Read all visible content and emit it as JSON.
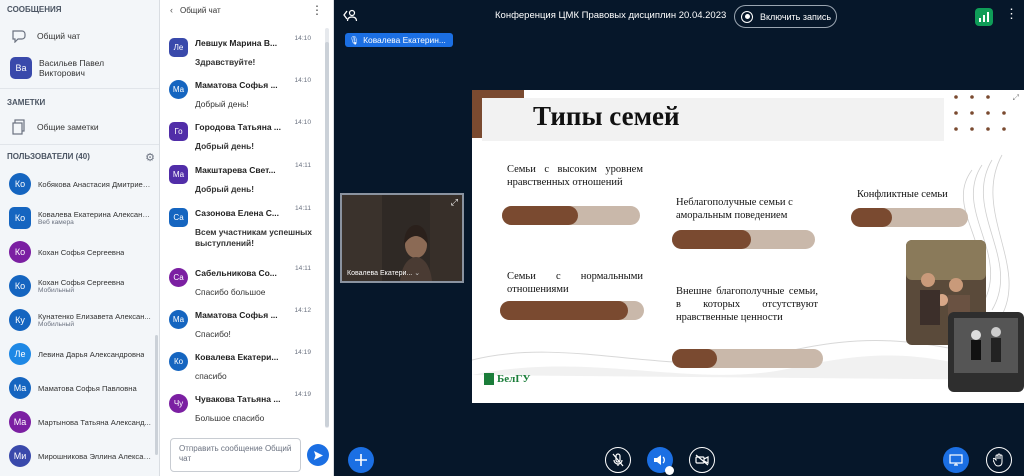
{
  "sidebar": {
    "messages_title": "СООБЩЕНИЯ",
    "public_chat_label": "Общий чат",
    "private_chat_label": "Васильев Павел Викторович",
    "private_chat_avatar": "Ва",
    "notes_title": "ЗАМЕТКИ",
    "shared_notes_label": "Общие заметки",
    "users_title": "ПОЛЬЗОВАТЕЛИ (40)",
    "users": [
      {
        "avatar": "Ко",
        "name": "Кобякова Анастасия Дмитриев...",
        "sub": "",
        "color": "#1565c0",
        "shape": "round"
      },
      {
        "avatar": "Ко",
        "name": "Ковалева Екатерина Александ...",
        "sub": "Веб камера",
        "color": "#1565c0",
        "shape": "square"
      },
      {
        "avatar": "Ко",
        "name": "Кохан Софья Сергеевна",
        "sub": "",
        "color": "#7b1fa2",
        "shape": "round"
      },
      {
        "avatar": "Ко",
        "name": "Кохан Софья Сергеевна",
        "sub": "Мобильный",
        "color": "#1565c0",
        "shape": "round"
      },
      {
        "avatar": "Ку",
        "name": "Кунатенко Елизавета Алексан...",
        "sub": "Мобильный",
        "color": "#1565c0",
        "shape": "round"
      },
      {
        "avatar": "Ле",
        "name": "Левина Дарья Александровна",
        "sub": "",
        "color": "#1e88e5",
        "shape": "round"
      },
      {
        "avatar": "Ма",
        "name": "Маматова Софья Павловна",
        "sub": "",
        "color": "#1565c0",
        "shape": "round"
      },
      {
        "avatar": "Ма",
        "name": "Мартынова Татьяна Александ...",
        "sub": "",
        "color": "#7b1fa2",
        "shape": "round"
      },
      {
        "avatar": "Ми",
        "name": "Мирошникова Эллина Алексан...",
        "sub": "",
        "color": "#3949ab",
        "shape": "round"
      }
    ]
  },
  "chat": {
    "title": "Общий чат",
    "input_placeholder": "Отправить сообщение Общий чат",
    "messages": [
      {
        "avatar": "Ле",
        "color": "#3949ab",
        "shape": "square",
        "name": "Левшук Марина В...",
        "time": "14:10",
        "text": "Здравствуйте!",
        "bold": true
      },
      {
        "avatar": "Ма",
        "color": "#1565c0",
        "shape": "round",
        "name": "Маматова Софья ...",
        "time": "14:10",
        "text": "Добрый день!",
        "bold": false
      },
      {
        "avatar": "Го",
        "color": "#512da8",
        "shape": "square",
        "name": "Городова Татьяна ...",
        "time": "14:10",
        "text": "Добрый день!",
        "bold": true
      },
      {
        "avatar": "Ма",
        "color": "#512da8",
        "shape": "square",
        "name": "Макштарева Свет...",
        "time": "14:11",
        "text": "Добрый день!",
        "bold": true
      },
      {
        "avatar": "Са",
        "color": "#1565c0",
        "shape": "square",
        "name": "Сазонова Елена С...",
        "time": "14:11",
        "text": "Всем участникам успешных выступлений!",
        "bold": true
      },
      {
        "avatar": "Са",
        "color": "#7b1fa2",
        "shape": "round",
        "name": "Сабельникова Со...",
        "time": "14:11",
        "text": "Спасибо большое",
        "bold": false
      },
      {
        "avatar": "Ма",
        "color": "#1565c0",
        "shape": "round",
        "name": "Маматова Софья ...",
        "time": "14:12",
        "text": "Спасибо!",
        "bold": false
      },
      {
        "avatar": "Ко",
        "color": "#1565c0",
        "shape": "round",
        "name": "Ковалева Екатери...",
        "time": "14:19",
        "text": "спасибо",
        "bold": false
      },
      {
        "avatar": "Чу",
        "color": "#7b1fa2",
        "shape": "round",
        "name": "Чувакова Татьяна ...",
        "time": "14:19",
        "text": "Большое спасибо",
        "bold": false
      }
    ]
  },
  "main": {
    "meeting_title": "Конференция ЦМК Правовых дисциплин 20.04.2023",
    "record_label": "Включить запись",
    "presenter_name": "Ковалева Екатерин...",
    "webcam_name": "Ковалева Екатери...",
    "slide": {
      "title": "Типы семей",
      "items": [
        {
          "text": "Семьи с высоким уровнем нравственных отношений",
          "level": 0.55
        },
        {
          "text": "Неблагополучные семьи с аморальным поведением",
          "level": 0.55
        },
        {
          "text": "Конфликтные семьи",
          "level": 0.35
        },
        {
          "text": "Семьи с нормальными отношениями",
          "level": 0.89
        },
        {
          "text": "Внешне благополучные семьи, в которых отсутствуют нравственные ценности",
          "level": 0.3
        }
      ],
      "logo_text": "БелГУ"
    }
  },
  "colors": {
    "accent": "#1b6fe3",
    "background": "#06172a",
    "slide_accent": "#7a4a30",
    "record_green": "#0f9d58"
  },
  "icons": [
    "chat-icon",
    "notes-icon",
    "gear-icon",
    "back-chevron-icon",
    "more-vertical-icon",
    "send-icon",
    "add-icon",
    "mic-off-icon",
    "audio-icon",
    "video-off-icon",
    "screen-share-icon",
    "raise-hand-icon",
    "connection-icon",
    "record-icon",
    "user-settings-icon",
    "fullscreen-icon"
  ]
}
